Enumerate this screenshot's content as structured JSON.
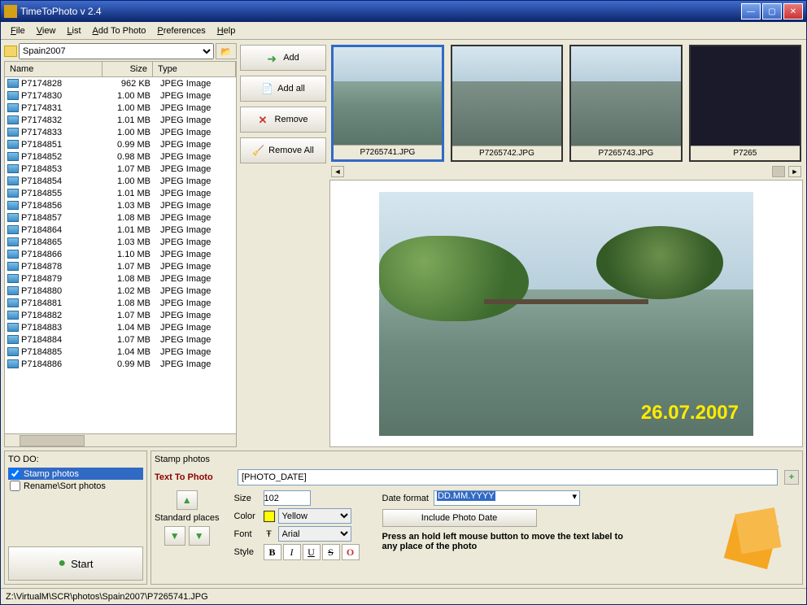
{
  "window": {
    "title": "TimeToPhoto v 2.4"
  },
  "menu": {
    "file": "File",
    "view": "View",
    "list": "List",
    "addto": "Add To Photo",
    "prefs": "Preferences",
    "help": "Help"
  },
  "folder": {
    "name": "Spain2007"
  },
  "fileheaders": {
    "name": "Name",
    "size": "Size",
    "type": "Type"
  },
  "files": [
    {
      "n": "P7174828",
      "s": "962 KB",
      "t": "JPEG Image"
    },
    {
      "n": "P7174830",
      "s": "1.00 MB",
      "t": "JPEG Image"
    },
    {
      "n": "P7174831",
      "s": "1.00 MB",
      "t": "JPEG Image"
    },
    {
      "n": "P7174832",
      "s": "1.01 MB",
      "t": "JPEG Image"
    },
    {
      "n": "P7174833",
      "s": "1.00 MB",
      "t": "JPEG Image"
    },
    {
      "n": "P7184851",
      "s": "0.99 MB",
      "t": "JPEG Image"
    },
    {
      "n": "P7184852",
      "s": "0.98 MB",
      "t": "JPEG Image"
    },
    {
      "n": "P7184853",
      "s": "1.07 MB",
      "t": "JPEG Image"
    },
    {
      "n": "P7184854",
      "s": "1.00 MB",
      "t": "JPEG Image"
    },
    {
      "n": "P7184855",
      "s": "1.01 MB",
      "t": "JPEG Image"
    },
    {
      "n": "P7184856",
      "s": "1.03 MB",
      "t": "JPEG Image"
    },
    {
      "n": "P7184857",
      "s": "1.08 MB",
      "t": "JPEG Image"
    },
    {
      "n": "P7184864",
      "s": "1.01 MB",
      "t": "JPEG Image"
    },
    {
      "n": "P7184865",
      "s": "1.03 MB",
      "t": "JPEG Image"
    },
    {
      "n": "P7184866",
      "s": "1.10 MB",
      "t": "JPEG Image"
    },
    {
      "n": "P7184878",
      "s": "1.07 MB",
      "t": "JPEG Image"
    },
    {
      "n": "P7184879",
      "s": "1.08 MB",
      "t": "JPEG Image"
    },
    {
      "n": "P7184880",
      "s": "1.02 MB",
      "t": "JPEG Image"
    },
    {
      "n": "P7184881",
      "s": "1.08 MB",
      "t": "JPEG Image"
    },
    {
      "n": "P7184882",
      "s": "1.07 MB",
      "t": "JPEG Image"
    },
    {
      "n": "P7184883",
      "s": "1.04 MB",
      "t": "JPEG Image"
    },
    {
      "n": "P7184884",
      "s": "1.07 MB",
      "t": "JPEG Image"
    },
    {
      "n": "P7184885",
      "s": "1.04 MB",
      "t": "JPEG Image"
    },
    {
      "n": "P7184886",
      "s": "0.99 MB",
      "t": "JPEG Image"
    }
  ],
  "buttons": {
    "add": "Add",
    "addall": "Add all",
    "remove": "Remove",
    "removeall": "Remove All",
    "start": "Start",
    "includedate": "Include Photo Date"
  },
  "thumbs": [
    {
      "cap": "P7265741.JPG",
      "sel": true
    },
    {
      "cap": "P7265742.JPG",
      "sel": false
    },
    {
      "cap": "P7265743.JPG",
      "sel": false
    },
    {
      "cap": "P7265",
      "sel": false
    }
  ],
  "preview": {
    "datestamp": "26.07.2007"
  },
  "todo": {
    "heading": "TO DO:",
    "stamp": "Stamp photos",
    "rename": "Rename\\Sort photos"
  },
  "stamp": {
    "heading": "Stamp photos",
    "ttp_label": "Text To Photo",
    "ttp_value": "[PHOTO_DATE]",
    "stdplaces": "Standard places",
    "size_label": "Size",
    "size_value": "102",
    "color_label": "Color",
    "color_value": "Yellow",
    "font_label": "Font",
    "font_value": "Arial",
    "style_label": "Style",
    "dateformat_label": "Date format",
    "dateformat_value": "DD.MM.YYYY",
    "hint": "Press an hold left mouse button to move the text label to any place of the photo"
  },
  "status": "Z:\\VirtualM\\SCR\\photos\\Spain2007\\P7265741.JPG"
}
